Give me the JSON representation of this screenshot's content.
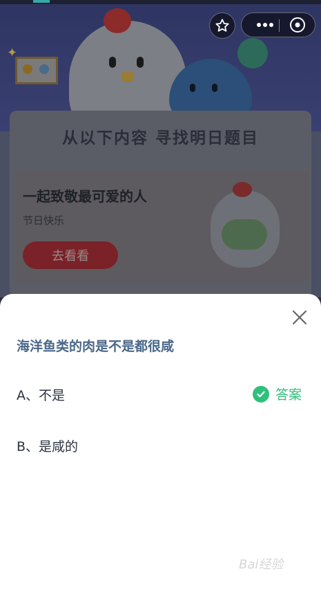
{
  "banner": {
    "title": "从以下内容  寻找明日题目",
    "card_title": "一起致敬最可爱的人",
    "card_subtitle": "节日快乐",
    "card_button": "去看看"
  },
  "quiz": {
    "question": "海洋鱼类的肉是不是都很咸",
    "options": [
      {
        "label": "A、不是"
      },
      {
        "label": "B、是咸的"
      }
    ],
    "answer_label": "答案",
    "answer_color": "#2fc07c"
  },
  "watermark": "Bai经验"
}
